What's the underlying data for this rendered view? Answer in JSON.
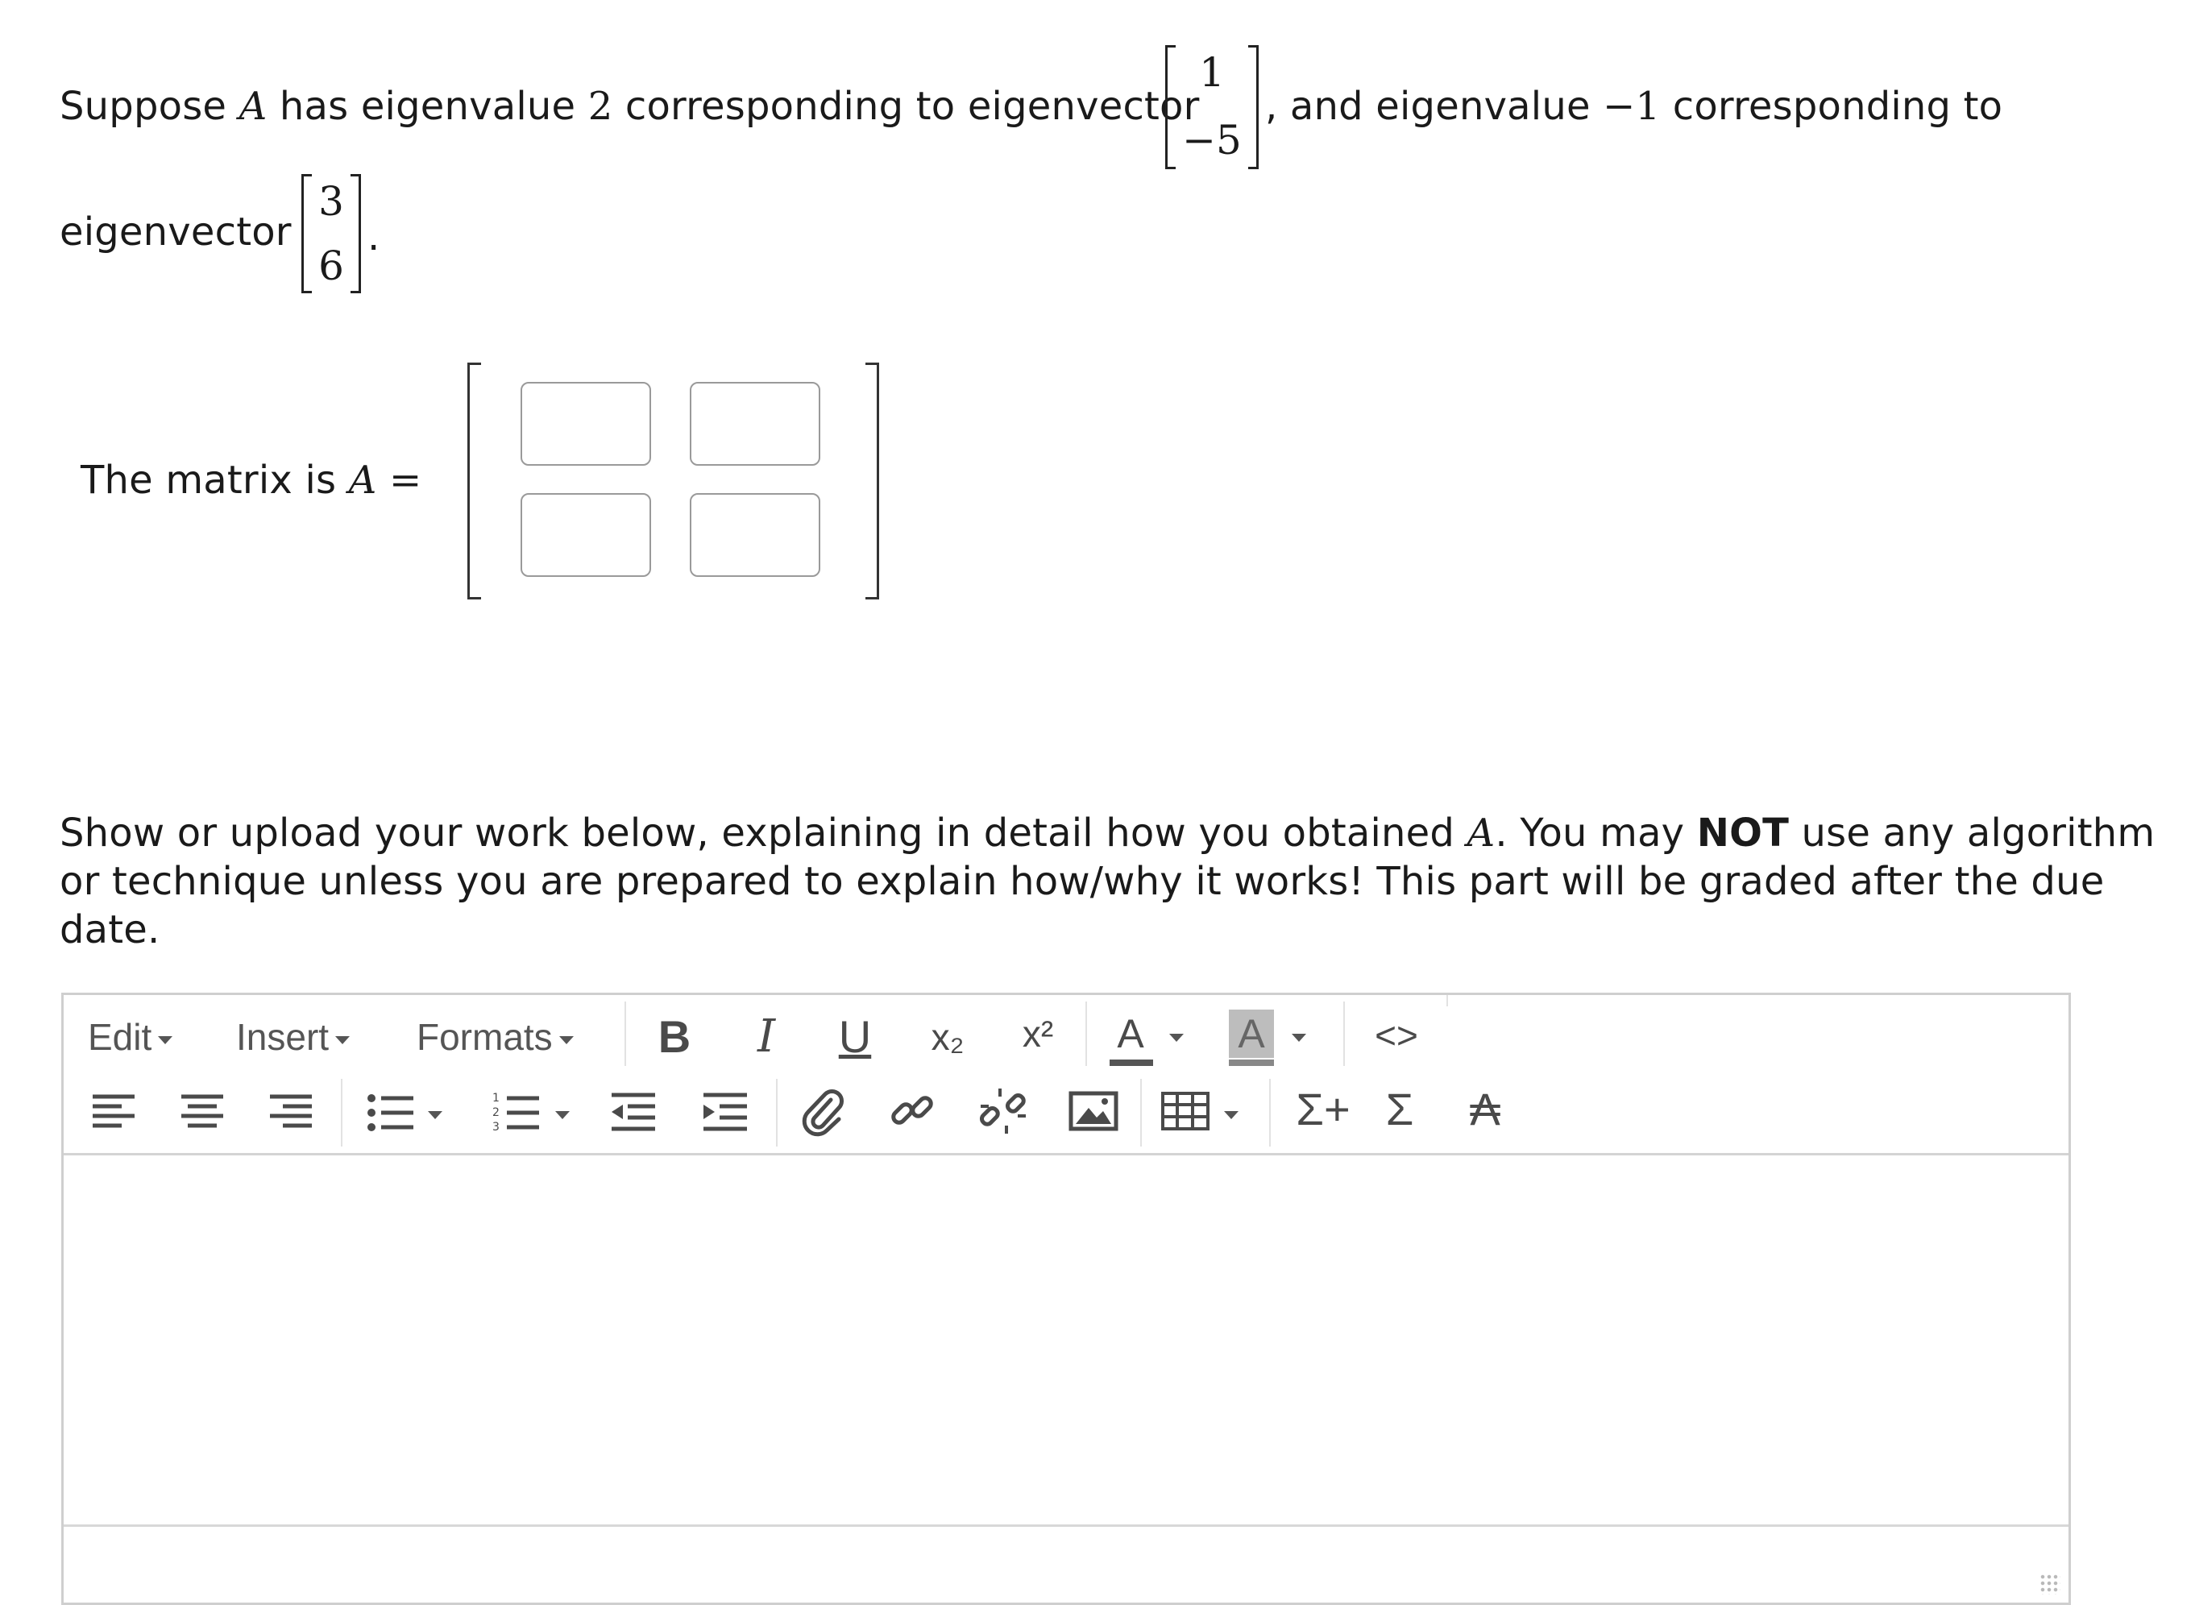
{
  "question": {
    "line1_a": "Suppose ",
    "var_A": "A",
    "line1_b": " has eigenvalue ",
    "eigenvalue1": "2",
    "line1_c": " corresponding to eigenvector ",
    "vector1": [
      "1",
      "−5"
    ],
    "line1_d": ", and eigenvalue ",
    "eigenvalue2": "−1",
    "line1_e": " corresponding to",
    "line2_a": "eigenvector ",
    "vector2": [
      "3",
      "6"
    ],
    "line2_b": "."
  },
  "matrix_prompt": {
    "label": "The matrix is ",
    "var_A": "A",
    "equals": " =",
    "cells": [
      "",
      "",
      "",
      ""
    ]
  },
  "instructions": {
    "line1_a": "Show or upload your work below, explaining in detail how you obtained ",
    "var_A": "A",
    "line1_b": ". You may ",
    "not": "NOT",
    "line1_c": " use any algorithm",
    "line2": "or technique unless you are prepared to explain how/why it works! This part will be graded after the due",
    "line3": "date."
  },
  "editor": {
    "menus": {
      "edit": "Edit",
      "insert": "Insert",
      "formats": "Formats"
    },
    "buttons": {
      "bold": "B",
      "italic": "I",
      "underline": "U",
      "subscript": "x₂",
      "superscript": "x²",
      "text_color": "A",
      "bg_color": "A",
      "code": "<>",
      "equation_add": "Σ+",
      "equation": "Σ",
      "charmap": "₳"
    },
    "content": ""
  },
  "colors": {
    "text": "#1a1a1a",
    "border": "#cfcfcf",
    "icon": "#4a4a4a",
    "input_border": "#9a9a9a"
  }
}
